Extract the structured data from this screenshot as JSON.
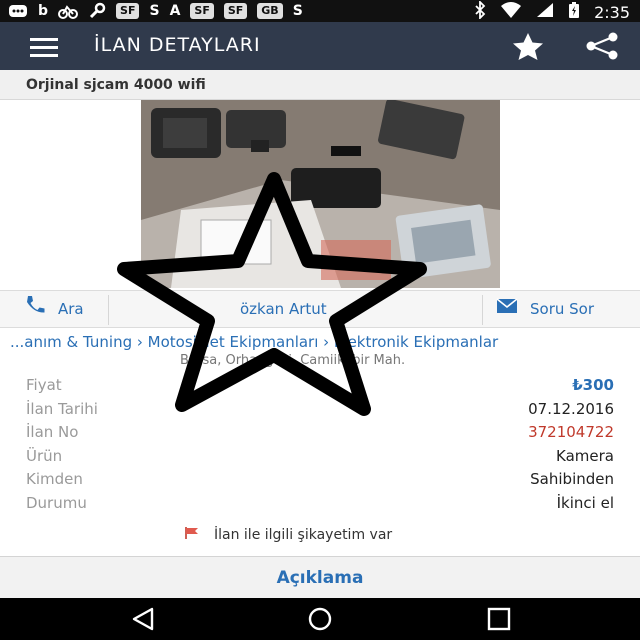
{
  "status_bar": {
    "left_icons": [
      "chat-icon",
      "b",
      "bike-icon",
      "wrench-icon",
      "SF",
      "S",
      "A",
      "SF",
      "SF",
      "mail-icon",
      "S"
    ],
    "left_text": [
      "b",
      "S",
      "A",
      "S"
    ],
    "badges": [
      "SF",
      "SF",
      "SF",
      "GB"
    ],
    "time": "2:35"
  },
  "app_bar": {
    "title": "İLAN DETAYLARI"
  },
  "listing": {
    "title": "Orjinal sjcam 4000 wifi"
  },
  "actions": {
    "call_label": "Ara",
    "seller_name": "özkan Artut",
    "message_label": "Soru Sor"
  },
  "breadcrumb": "...anım & Tuning › Motosiklet Ekipmanları › Elektronik Ekipmanlar",
  "location": "Bursa, Orhangazi, Camiikebir Mah.",
  "info": [
    {
      "label": "Fiyat",
      "value": "₺300"
    },
    {
      "label": "İlan Tarihi",
      "value": "07.12.2016"
    },
    {
      "label": "İlan No",
      "value": "372104722"
    },
    {
      "label": "Ürün",
      "value": "Kamera"
    },
    {
      "label": "Kimden",
      "value": "Sahibinden"
    },
    {
      "label": "Durumu",
      "value": "İkinci el"
    }
  ],
  "complaint_label": "İlan ile ilgili şikayetim var",
  "description_tab": "Açıklama",
  "colors": {
    "app_bar": "#303a4c",
    "link_blue": "#2a6fb5",
    "listing_id_red": "#c0392b"
  }
}
